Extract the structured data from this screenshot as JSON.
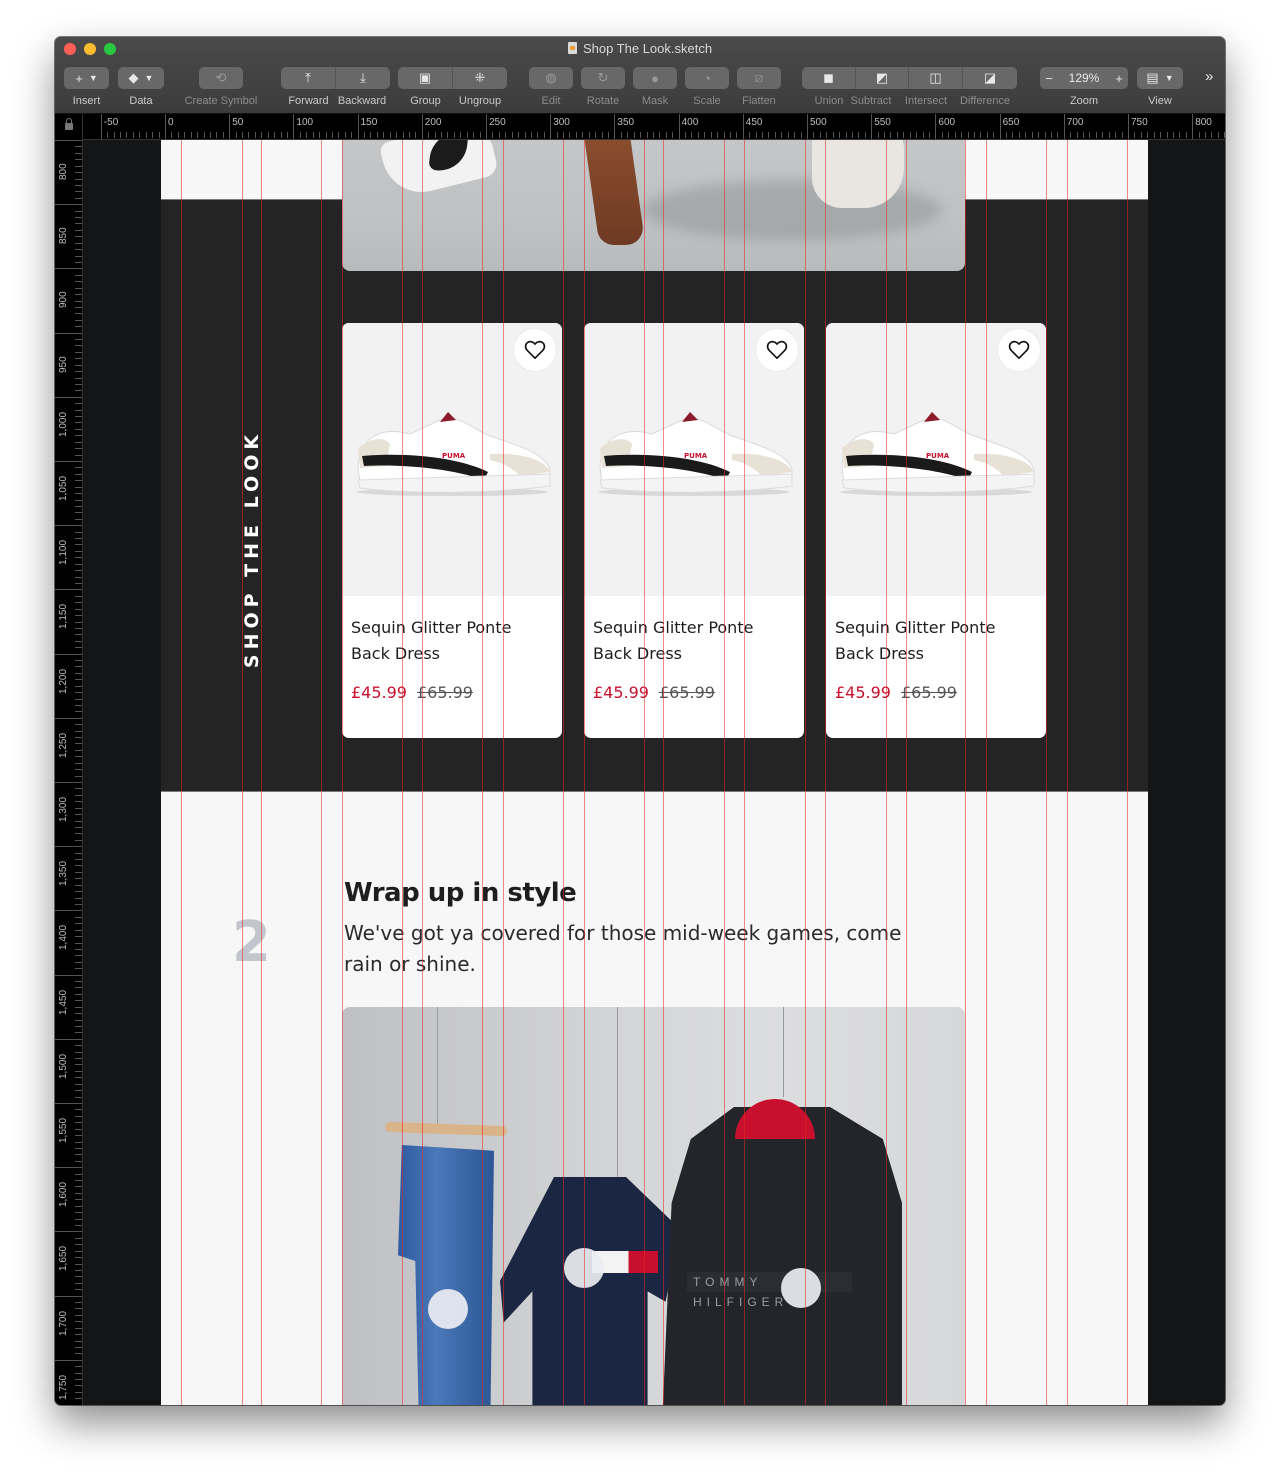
{
  "window": {
    "title": "Shop The Look.sketch"
  },
  "toolbar": {
    "insert": "Insert",
    "data": "Data",
    "create_symbol": "Create Symbol",
    "forward": "Forward",
    "backward": "Backward",
    "group": "Group",
    "ungroup": "Ungroup",
    "edit": "Edit",
    "rotate": "Rotate",
    "mask": "Mask",
    "scale": "Scale",
    "flatten": "Flatten",
    "union": "Union",
    "subtract": "Subtract",
    "intersect": "Intersect",
    "difference": "Difference",
    "zoom_label": "Zoom",
    "zoom_value": "129%",
    "view_label": "View",
    "more": "»"
  },
  "ruler": {
    "horizontal": [
      "-50",
      "0",
      "50",
      "100",
      "150",
      "200",
      "250",
      "300",
      "350",
      "400",
      "450",
      "500",
      "550",
      "600",
      "650",
      "700",
      "750",
      "800"
    ],
    "vertical": [
      "800",
      "850",
      "900",
      "950",
      "1,000",
      "1,050",
      "1,100",
      "1,150",
      "1,200",
      "1,250",
      "1,300",
      "1,350",
      "1,400",
      "1,450",
      "1,500",
      "1,550",
      "1,600",
      "1,650",
      "1,700",
      "1,750"
    ]
  },
  "artboard": {
    "shop_the_look": "SHOP THE LOOK",
    "products": [
      {
        "name": "Sequin Glitter Ponte Back Dress",
        "price": "£45.99",
        "was_price": "£65.99",
        "favourite": false
      },
      {
        "name": "Sequin Glitter Ponte Back Dress",
        "price": "£45.99",
        "was_price": "£65.99",
        "favourite": false
      },
      {
        "name": "Sequin Glitter Ponte Back Dress",
        "price": "£45.99",
        "was_price": "£65.99",
        "favourite": false
      }
    ],
    "step": {
      "number": "2",
      "title": "Wrap up in style",
      "body": "We've got ya covered for those mid-week games, come rain or shine."
    },
    "look_image": {
      "brand_text": "TOMMY HILFIGER",
      "hotspots": 3
    }
  },
  "colors": {
    "sale_price": "#c8102e",
    "dark_band": "#242424",
    "artboard_bg": "#f7f7f7",
    "guide": "#e62828"
  }
}
